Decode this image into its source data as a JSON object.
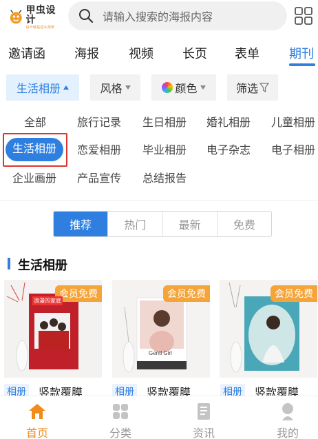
{
  "header": {
    "logo_main": "甲虫设计",
    "logo_sub": "设计就是这么简单",
    "search_placeholder": "请输入搜索的海报内容"
  },
  "tabs": [
    {
      "label": "邀请函"
    },
    {
      "label": "海报"
    },
    {
      "label": "视频"
    },
    {
      "label": "长页"
    },
    {
      "label": "表单"
    },
    {
      "label": "期刊"
    }
  ],
  "filters": {
    "category": "生活相册",
    "style": "风格",
    "color": "颜色",
    "screen": "筛选"
  },
  "categories": [
    {
      "label": "全部"
    },
    {
      "label": "旅行记录"
    },
    {
      "label": "生日相册"
    },
    {
      "label": "婚礼相册"
    },
    {
      "label": "儿童相册"
    },
    {
      "label": "生活相册"
    },
    {
      "label": "恋爱相册"
    },
    {
      "label": "毕业相册"
    },
    {
      "label": "电子杂志"
    },
    {
      "label": "电子相册"
    },
    {
      "label": "企业画册"
    },
    {
      "label": "产品宣传"
    },
    {
      "label": "总结报告"
    }
  ],
  "sort": [
    "推荐",
    "热门",
    "最新",
    "免费"
  ],
  "section": {
    "title": "生活相册"
  },
  "cards": [
    {
      "badge": "会员免费",
      "tag": "相册",
      "title": "竖款覆膜",
      "cover_text": "浪漫的家庭"
    },
    {
      "badge": "会员免费",
      "tag": "相册",
      "title": "竖款覆膜",
      "cover_text": "Gentl Girl"
    },
    {
      "badge": "会员免费",
      "tag": "相册",
      "title": "竖款覆膜",
      "cover_text": ""
    }
  ],
  "nav": [
    {
      "label": "首页"
    },
    {
      "label": "分类"
    },
    {
      "label": "资讯"
    },
    {
      "label": "我的"
    }
  ],
  "colors": {
    "accent": "#2f7fe0",
    "badge": "#f5a43a",
    "highlight": "#d9382f",
    "nav_active": "#f08b1c"
  }
}
